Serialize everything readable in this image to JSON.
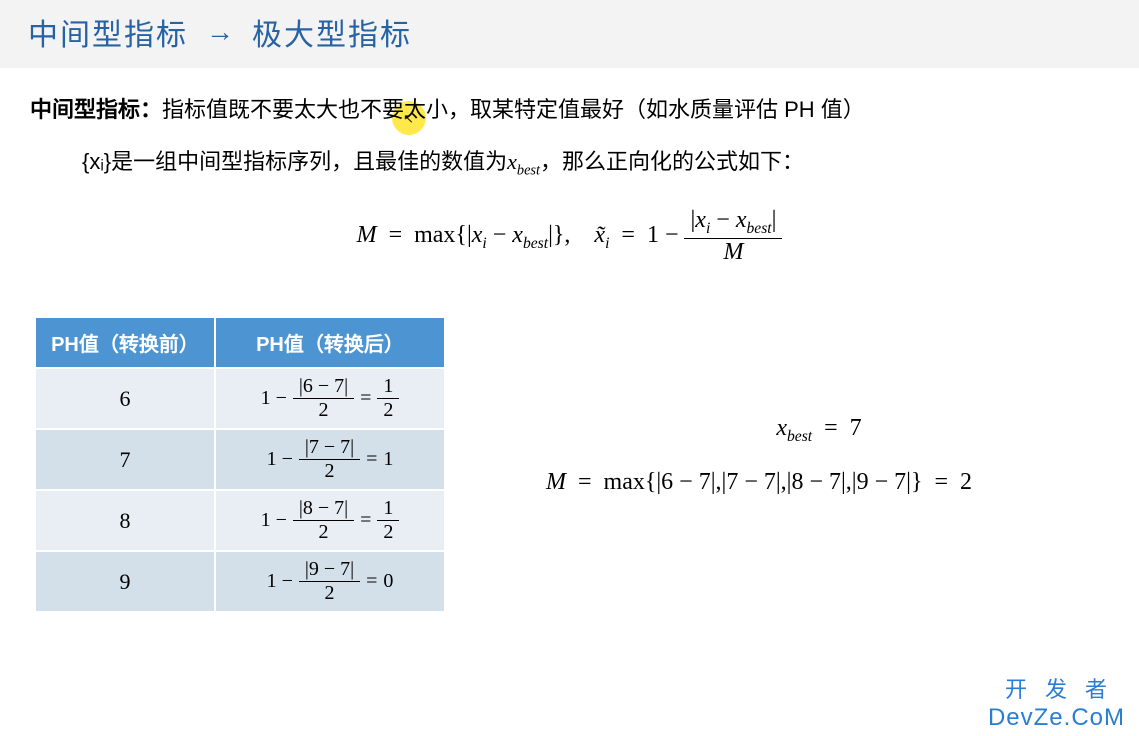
{
  "header": {
    "left": "中间型指标",
    "right": "极大型指标"
  },
  "definition": {
    "label": "中间型指标：",
    "text": "指标值既不要太大也不要太小，取某特定值最好（如水质量评估 PH 值）"
  },
  "sequence_text_pre": "{xᵢ}是一组中间型指标序列，且最佳的数值为",
  "sequence_xbest": "x_best",
  "sequence_text_post": "，那么正向化的公式如下：",
  "formula": {
    "M_left": "M  =  max{|xᵢ − x_best|},",
    "xtilde_left": "x̃ᵢ  =  1 −",
    "frac_num": "|xᵢ − x_best|",
    "frac_den": "M"
  },
  "table": {
    "headers": [
      "PH值（转换前）",
      "PH值（转换后）"
    ],
    "rows": [
      {
        "before": "6",
        "num": "|6 − 7|",
        "den": "2",
        "rnum": "1",
        "rden": "2"
      },
      {
        "before": "7",
        "num": "|7 − 7|",
        "den": "2",
        "result_simple": "1"
      },
      {
        "before": "8",
        "num": "|8 − 7|",
        "den": "2",
        "rnum": "1",
        "rden": "2"
      },
      {
        "before": "9",
        "num": "|9 − 7|",
        "den": "2",
        "result_simple": "0"
      }
    ]
  },
  "side": {
    "xbest": "x_best  =  7",
    "M_expr": "M  =  max{|6 − 7|,|7 − 7|,|8 − 7|,|9 − 7|}  =  2"
  },
  "watermark": {
    "line1": "开发者",
    "line2": "DevZe.CoM"
  }
}
